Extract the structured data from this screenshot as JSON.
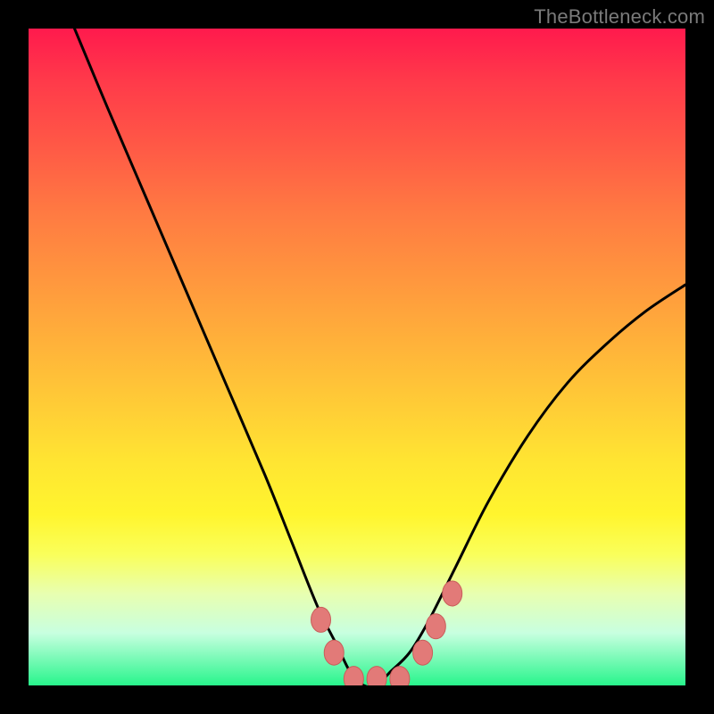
{
  "attribution": "TheBottleneck.com",
  "colors": {
    "curve_stroke": "#000000",
    "marker_fill": "#e27a78",
    "marker_stroke": "#c95d5a"
  },
  "chart_data": {
    "type": "line",
    "title": "",
    "xlabel": "",
    "ylabel": "",
    "xlim": [
      0,
      100
    ],
    "ylim": [
      0,
      100
    ],
    "series": [
      {
        "name": "bottleneck-curve",
        "x": [
          7,
          12,
          18,
          24,
          30,
          36,
          40,
          44,
          47,
          49,
          51,
          53,
          55,
          58,
          61,
          65,
          70,
          76,
          82,
          88,
          94,
          100
        ],
        "y": [
          100,
          88,
          74,
          60,
          46,
          32,
          22,
          12,
          6,
          2,
          0,
          0,
          2,
          5,
          10,
          18,
          28,
          38,
          46,
          52,
          57,
          61
        ]
      }
    ],
    "markers": [
      {
        "x": 44.5,
        "y": 10
      },
      {
        "x": 46.5,
        "y": 5
      },
      {
        "x": 49.5,
        "y": 1
      },
      {
        "x": 53.0,
        "y": 1
      },
      {
        "x": 56.5,
        "y": 1
      },
      {
        "x": 60.0,
        "y": 5
      },
      {
        "x": 62.0,
        "y": 9
      },
      {
        "x": 64.5,
        "y": 14
      }
    ],
    "marker_rx": 11,
    "marker_ry": 14
  }
}
